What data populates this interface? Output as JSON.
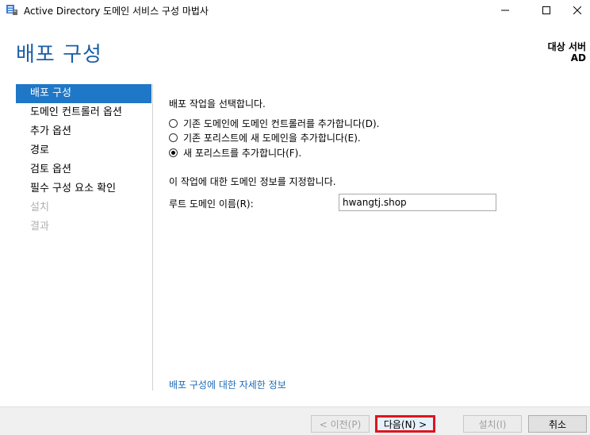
{
  "window": {
    "title": "Active Directory 도메인 서비스 구성 마법사"
  },
  "header": {
    "title": "배포 구성",
    "target_label": "대상 서버",
    "target_value": "AD"
  },
  "nav": {
    "items": [
      {
        "label": "배포 구성",
        "state": "active"
      },
      {
        "label": "도메인 컨트롤러 옵션",
        "state": "normal"
      },
      {
        "label": "추가 옵션",
        "state": "normal"
      },
      {
        "label": "경로",
        "state": "normal"
      },
      {
        "label": "검토 옵션",
        "state": "normal"
      },
      {
        "label": "필수 구성 요소 확인",
        "state": "normal"
      },
      {
        "label": "설치",
        "state": "disabled"
      },
      {
        "label": "결과",
        "state": "disabled"
      }
    ]
  },
  "main": {
    "prompt": "배포 작업을 선택합니다.",
    "options": [
      {
        "label": "기존 도메인에 도메인 컨트롤러를 추가합니다(D).",
        "checked": false
      },
      {
        "label": "기존 포리스트에 새 도메인을 추가합니다(E).",
        "checked": false
      },
      {
        "label": "새 포리스트를 추가합니다(F).",
        "checked": true
      }
    ],
    "section_label": "이 작업에 대한 도메인 정보를 지정합니다.",
    "root_domain_label": "루트 도메인 이름(R):",
    "root_domain_value": "hwangtj.shop",
    "more_info_link": "배포 구성에 대한 자세한 정보"
  },
  "footer": {
    "prev_label": "< 이전(P)",
    "next_label": "다음(N) >",
    "install_label": "설치(I)",
    "cancel_label": "취소"
  },
  "colors": {
    "accent": "#1f77c7",
    "title_blue": "#1c5fa6",
    "link": "#1c6bb8",
    "highlight_border": "#e0141e"
  },
  "icons": {
    "app": "ad-ds-wizard-icon",
    "minimize": "minimize-icon",
    "maximize": "maximize-icon",
    "close": "close-icon"
  }
}
